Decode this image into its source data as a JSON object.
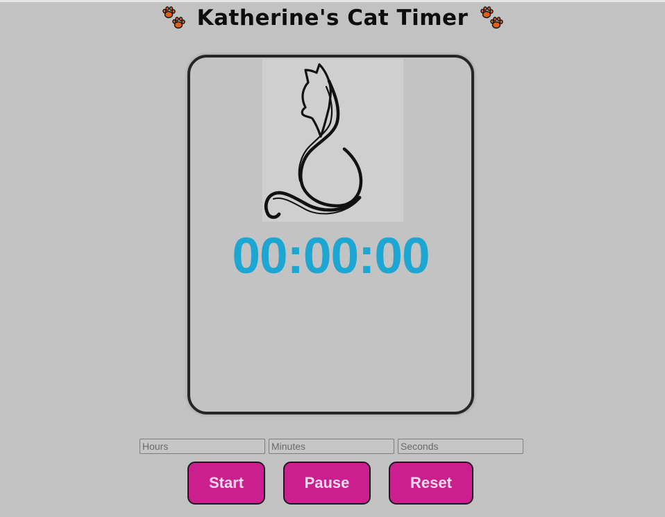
{
  "header": {
    "title": "Katherine's Cat Timer",
    "left_icon": "paw-prints-icon",
    "right_icon": "paw-prints-icon",
    "paw_color": "#e0601a"
  },
  "timer": {
    "image_subject": "cat-line-drawing",
    "display": "00:00:00",
    "display_color": "#1ea6d3"
  },
  "inputs": {
    "hours_placeholder": "Hours",
    "minutes_placeholder": "Minutes",
    "seconds_placeholder": "Seconds"
  },
  "controls": {
    "start_label": "Start",
    "pause_label": "Pause",
    "reset_label": "Reset",
    "button_color": "#cc1f8f"
  }
}
